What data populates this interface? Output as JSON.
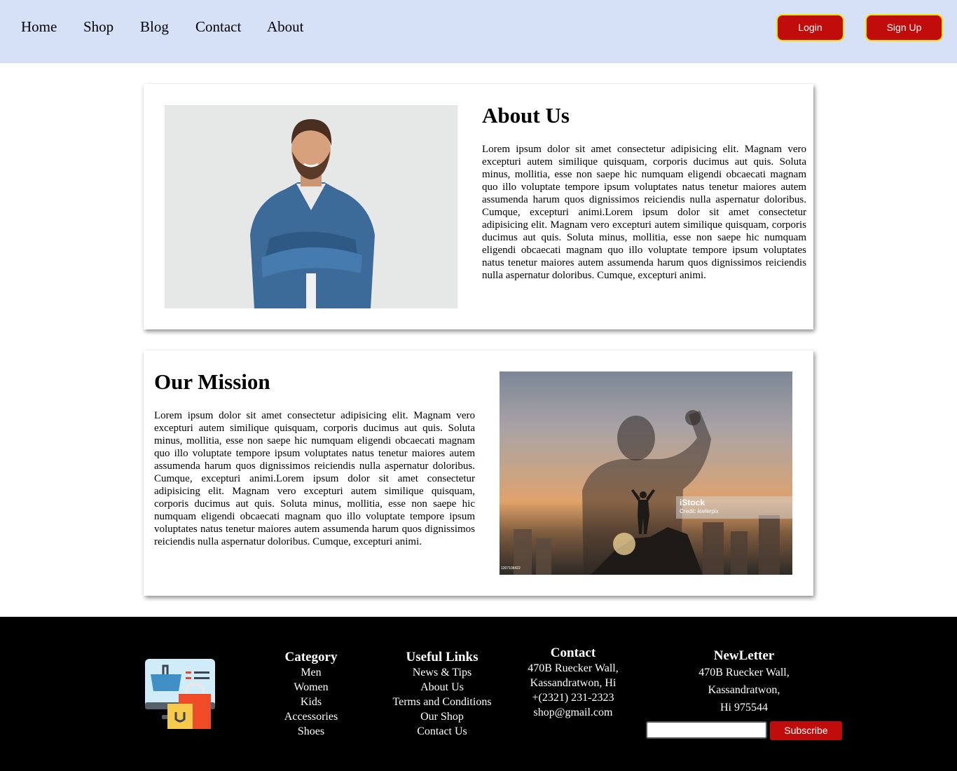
{
  "nav": {
    "links": [
      "Home",
      "Shop",
      "Blog",
      "Contact",
      "About"
    ],
    "login_label": "Login",
    "signup_label": "Sign Up"
  },
  "about": {
    "title": "About Us",
    "body": "Lorem ipsum dolor sit amet consectetur adipisicing elit. Magnam vero excepturi autem similique quisquam, corporis ducimus aut quis. Soluta minus, mollitia, esse non saepe hic numquam eligendi obcaecati magnam quo illo voluptate tempore ipsum voluptates natus tenetur maiores autem assumenda harum quos dignissimos reiciendis nulla aspernatur doloribus. Cumque, excepturi animi.Lorem ipsum dolor sit amet consectetur adipisicing elit. Magnam vero excepturi autem similique quisquam, corporis ducimus aut quis. Soluta minus, mollitia, esse non saepe hic numquam eligendi obcaecati magnam quo illo voluptate tempore ipsum voluptates natus tenetur maiores autem assumenda harum quos dignissimos reiciendis nulla aspernatur doloribus. Cumque, excepturi animi."
  },
  "mission": {
    "title": "Our Mission",
    "body": "Lorem ipsum dolor sit amet consectetur adipisicing elit. Magnam vero excepturi autem similique quisquam, corporis ducimus aut quis. Soluta minus, mollitia, esse non saepe hic numquam eligendi obcaecati magnam quo illo voluptate tempore ipsum voluptates natus tenetur maiores autem assumenda harum quos dignissimos reiciendis nulla aspernatur doloribus. Cumque, excepturi animi.Lorem ipsum dolor sit amet consectetur adipisicing elit. Magnam vero excepturi autem similique quisquam, corporis ducimus aut quis. Soluta minus, mollitia, esse non saepe hic numquam eligendi obcaecati magnam quo illo voluptate tempore ipsum voluptates natus tenetur maiores autem assumenda harum quos dignissimos reiciendis nulla aspernatur doloribus. Cumque, excepturi animi.",
    "watermark": "iStock",
    "credit": "Credit: kieferpix",
    "image_id": "1207108422"
  },
  "footer": {
    "category": {
      "title": "Category",
      "items": [
        "Men",
        "Women",
        "Kids",
        "Accessories",
        "Shoes"
      ]
    },
    "useful_links": {
      "title": "Useful Links",
      "items": [
        "News & Tips",
        "About Us",
        "Terms and Conditions",
        "Our Shop",
        "Contact Us"
      ]
    },
    "contact": {
      "title": "Contact",
      "lines": [
        "470B Ruecker Wall,",
        "Kassandratwon, Hi",
        "+(2321) 231-2323",
        "shop@gmail.com"
      ]
    },
    "newsletter": {
      "title": "NewLetter",
      "lines": [
        "470B Ruecker Wall,",
        "Kassandratwon,",
        "Hi 975544"
      ],
      "button_label": "Subscribe",
      "input_value": ""
    }
  },
  "colors": {
    "header_bg": "#d6e0f7",
    "accent_red": "#c10c0c",
    "button_border": "#f2e600",
    "footer_bg": "#000000"
  },
  "icons": {
    "logo": "shopping-monitor-icon"
  }
}
